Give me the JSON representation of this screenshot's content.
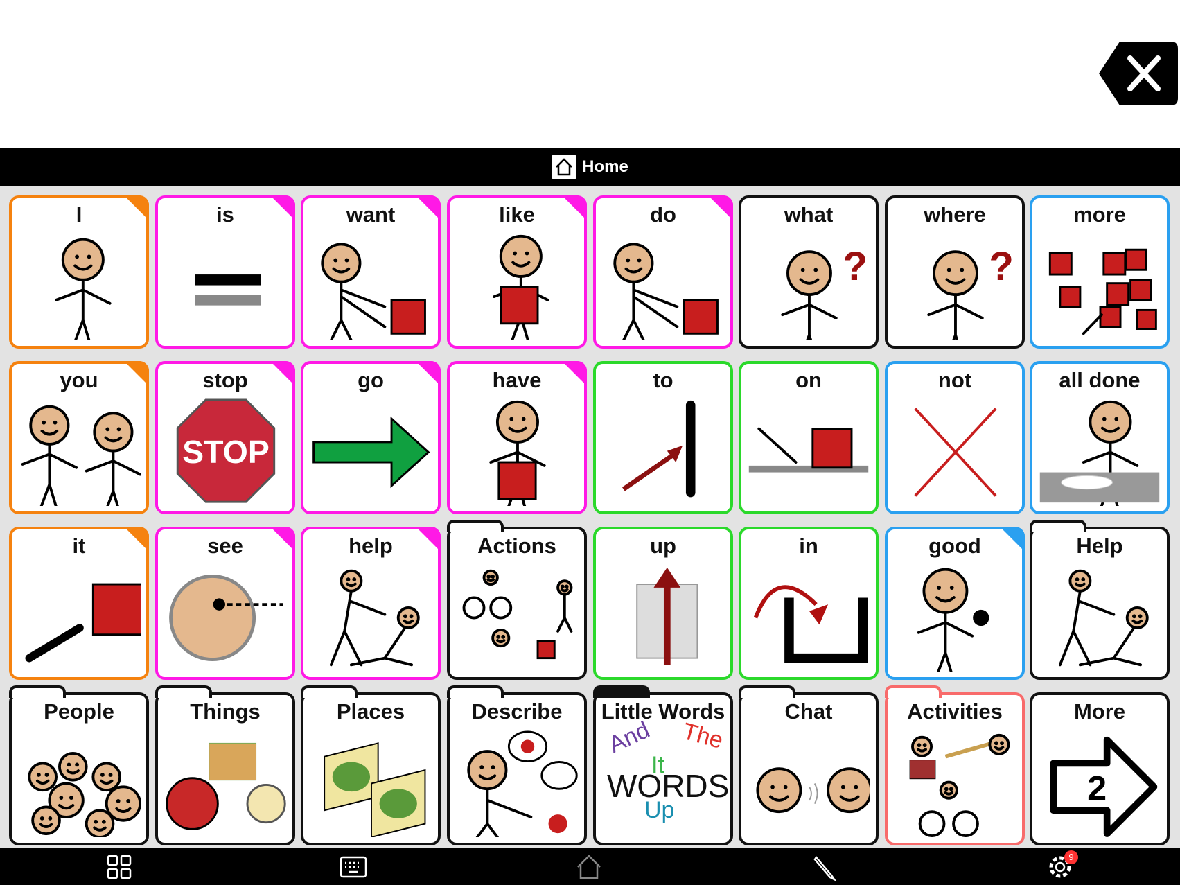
{
  "header": {
    "title": "Home",
    "icon": "home-icon"
  },
  "close_button": {
    "icon": "close-icon"
  },
  "colors": {
    "orange": "#f5820f",
    "magenta": "#ff19e6",
    "green": "#2bd92b",
    "blue": "#2aa0f0",
    "black": "#111111",
    "salmon": "#f86b6b"
  },
  "cards": [
    {
      "label": "I",
      "color": "orange",
      "corner": true,
      "folder": false,
      "icon": "person-pointing-self"
    },
    {
      "label": "is",
      "color": "magenta",
      "corner": true,
      "folder": false,
      "icon": "equals"
    },
    {
      "label": "want",
      "color": "magenta",
      "corner": true,
      "folder": false,
      "icon": "person-reaching"
    },
    {
      "label": "like",
      "color": "magenta",
      "corner": true,
      "folder": false,
      "icon": "person-hugging-square"
    },
    {
      "label": "do",
      "color": "magenta",
      "corner": true,
      "folder": false,
      "icon": "person-reaching"
    },
    {
      "label": "what",
      "color": "black",
      "corner": false,
      "folder": false,
      "icon": "person-question"
    },
    {
      "label": "where",
      "color": "black",
      "corner": false,
      "folder": false,
      "icon": "person-question"
    },
    {
      "label": "more",
      "color": "blue",
      "corner": false,
      "folder": false,
      "icon": "red-squares"
    },
    {
      "label": "you",
      "color": "orange",
      "corner": true,
      "folder": false,
      "icon": "two-people"
    },
    {
      "label": "stop",
      "color": "magenta",
      "corner": true,
      "folder": false,
      "icon": "stop-sign"
    },
    {
      "label": "go",
      "color": "magenta",
      "corner": true,
      "folder": false,
      "icon": "green-arrow"
    },
    {
      "label": "have",
      "color": "magenta",
      "corner": true,
      "folder": false,
      "icon": "person-holding-square"
    },
    {
      "label": "to",
      "color": "green",
      "corner": false,
      "folder": false,
      "icon": "arrow-to-line"
    },
    {
      "label": "on",
      "color": "green",
      "corner": false,
      "folder": false,
      "icon": "arrow-on-square"
    },
    {
      "label": "not",
      "color": "blue",
      "corner": false,
      "folder": false,
      "icon": "red-cross"
    },
    {
      "label": "all done",
      "color": "blue",
      "corner": false,
      "folder": false,
      "icon": "person-plate"
    },
    {
      "label": "it",
      "color": "orange",
      "corner": true,
      "folder": false,
      "icon": "hand-pointing-square"
    },
    {
      "label": "see",
      "color": "magenta",
      "corner": true,
      "folder": false,
      "icon": "eye-face"
    },
    {
      "label": "help",
      "color": "magenta",
      "corner": true,
      "folder": false,
      "icon": "people-helping"
    },
    {
      "label": "Actions",
      "color": "black",
      "corner": false,
      "folder": true,
      "icon": "actions-collage"
    },
    {
      "label": "up",
      "color": "green",
      "corner": false,
      "folder": false,
      "icon": "arrow-up"
    },
    {
      "label": "in",
      "color": "green",
      "corner": false,
      "folder": false,
      "icon": "arrow-in"
    },
    {
      "label": "good",
      "color": "blue",
      "corner": true,
      "folder": false,
      "icon": "person-thumbs-up"
    },
    {
      "label": "Help",
      "color": "black",
      "corner": false,
      "folder": true,
      "icon": "people-helping"
    },
    {
      "label": "People",
      "color": "black",
      "corner": false,
      "folder": true,
      "icon": "faces-group"
    },
    {
      "label": "Things",
      "color": "black",
      "corner": false,
      "folder": true,
      "icon": "things-collage"
    },
    {
      "label": "Places",
      "color": "black",
      "corner": false,
      "folder": true,
      "icon": "maps"
    },
    {
      "label": "Describe",
      "color": "black",
      "corner": false,
      "folder": true,
      "icon": "person-speech"
    },
    {
      "label": "Little Words",
      "color": "black",
      "corner": false,
      "folder": true,
      "icon": "little-words",
      "tab_filled": true
    },
    {
      "label": "Chat",
      "color": "black",
      "corner": false,
      "folder": true,
      "icon": "faces-chat"
    },
    {
      "label": "Activities",
      "color": "salmon",
      "corner": false,
      "folder": true,
      "icon": "activities-collage"
    },
    {
      "label": "More",
      "color": "black",
      "corner": false,
      "folder": false,
      "icon": "arrow-2"
    }
  ],
  "little_words": [
    {
      "text": "And",
      "color": "#6b3fa0"
    },
    {
      "text": "It",
      "color": "#3bb54a"
    },
    {
      "text": "The",
      "color": "#e0302a"
    },
    {
      "text": "WORDS",
      "color": "#111111"
    },
    {
      "text": "Up",
      "color": "#1a8fb0"
    }
  ],
  "more_page_number": "2",
  "bottom_bar": [
    {
      "name": "grid-icon"
    },
    {
      "name": "keyboard-icon"
    },
    {
      "name": "home-icon"
    },
    {
      "name": "pencil-icon"
    },
    {
      "name": "settings-icon",
      "badge": "9"
    }
  ]
}
